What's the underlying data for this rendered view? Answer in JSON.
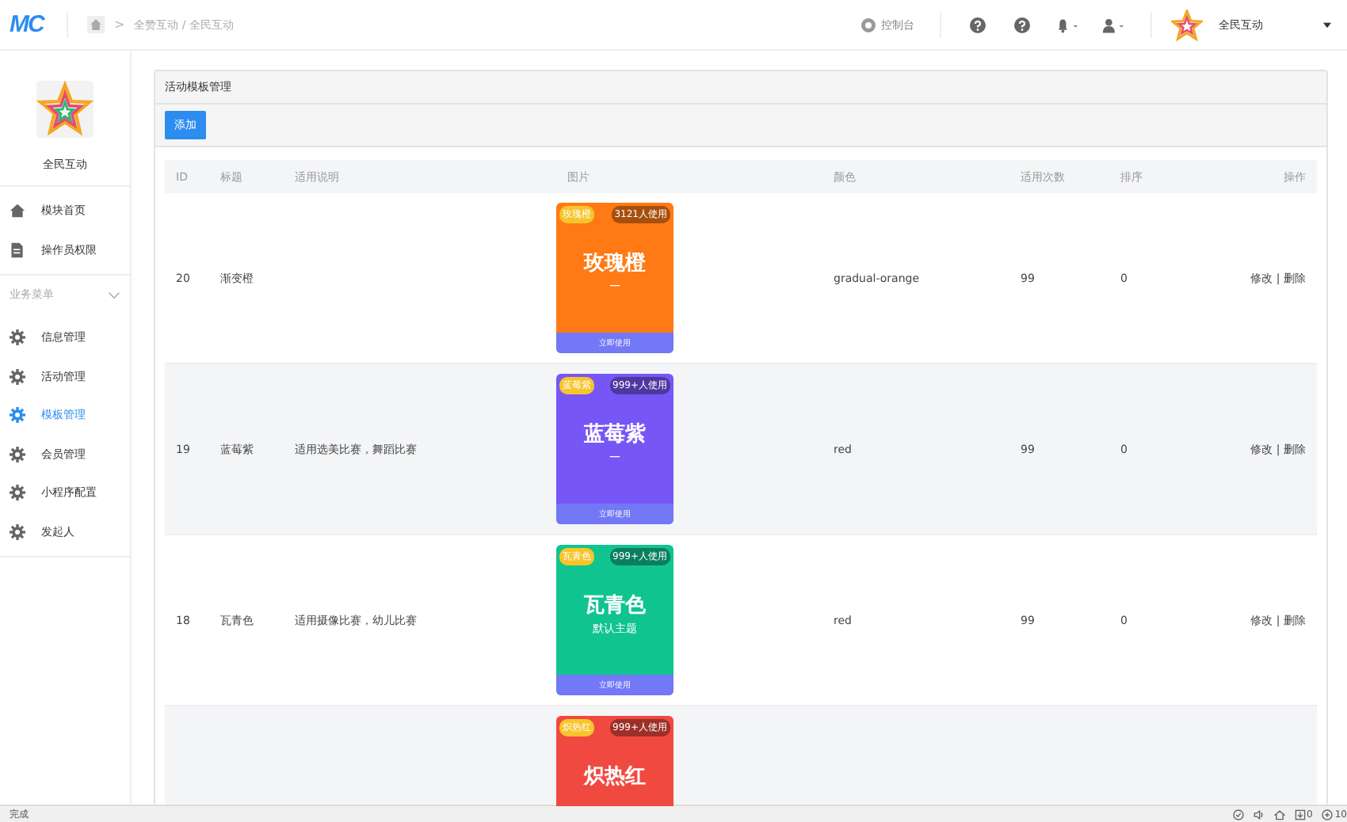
{
  "topbar": {
    "logo": "MC",
    "breadcrumb_sep": ">",
    "breadcrumb": "全赞互动 / 全民互动",
    "console": "控制台",
    "account_name": "全民互动"
  },
  "sidebar": {
    "brand": "全民互动",
    "items": [
      {
        "label": "模块首页",
        "selected": false
      },
      {
        "label": "操作员权限",
        "selected": false
      }
    ],
    "section": {
      "label": "业务菜单",
      "expanded": true,
      "items": [
        {
          "label": "信息管理",
          "selected": false
        },
        {
          "label": "活动管理",
          "selected": false
        },
        {
          "label": "模板管理",
          "selected": true
        },
        {
          "label": "会员管理",
          "selected": false
        },
        {
          "label": "小程序配置",
          "selected": false
        },
        {
          "label": "发起人",
          "selected": false
        }
      ]
    }
  },
  "panel": {
    "title": "活动模板管理",
    "add_button": "添加"
  },
  "table": {
    "columns": [
      "ID",
      "标题",
      "适用说明",
      "图片",
      "颜色",
      "适用次数",
      "排序",
      "操作"
    ],
    "rows": [
      {
        "id": "20",
        "title": "渐变橙",
        "description": "",
        "card": {
          "color": "#ff7a14",
          "tag": "玫瑰橙",
          "badge": "3121人使用",
          "name": "玫瑰橙",
          "subtitle": "一",
          "button": "立即使用"
        },
        "color_name": "gradual-orange",
        "uses": "99",
        "sort": "0",
        "edit": "修改",
        "separator": "|",
        "delete": "删除"
      },
      {
        "id": "19",
        "title": "蓝莓紫",
        "description": "适用选美比赛，舞蹈比赛",
        "card": {
          "color": "#7756f6",
          "tag": "蓝莓紫",
          "badge": "999+人使用",
          "name": "蓝莓紫",
          "subtitle": "一",
          "button": "立即使用"
        },
        "color_name": "red",
        "uses": "99",
        "sort": "0",
        "edit": "修改",
        "separator": "|",
        "delete": "删除"
      },
      {
        "id": "18",
        "title": "瓦青色",
        "description": "适用摄像比赛，幼儿比赛",
        "card": {
          "color": "#10c48f",
          "tag": "瓦青色",
          "badge": "999+人使用",
          "name": "瓦青色",
          "subtitle": "默认主题",
          "button": "立即使用"
        },
        "color_name": "red",
        "uses": "99",
        "sort": "0",
        "edit": "修改",
        "separator": "|",
        "delete": "删除"
      },
      {
        "card": {
          "color": "#f04a40",
          "tag": "炽热红",
          "badge": "999+人使用",
          "name": "炽热红"
        }
      }
    ]
  },
  "status_bar": {
    "text": "完成",
    "count": "0",
    "zoom": "10"
  }
}
